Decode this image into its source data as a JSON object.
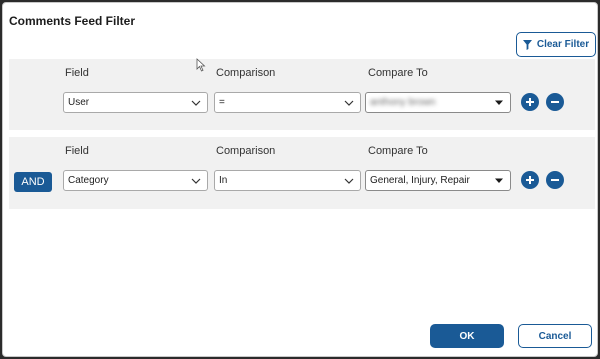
{
  "dialog": {
    "title": "Comments Feed Filter",
    "clear_filter_label": "Clear Filter"
  },
  "columns": {
    "field": "Field",
    "comparison": "Comparison",
    "compare_to": "Compare To"
  },
  "rows": [
    {
      "connector": "",
      "field": "User",
      "comparison": "=",
      "compare_to": "anthony brown",
      "compare_to_blurred": true
    },
    {
      "connector": "AND",
      "field": "Category",
      "comparison": "In",
      "compare_to": "General, Injury, Repair",
      "compare_to_blurred": false
    }
  ],
  "footer": {
    "ok_label": "OK",
    "cancel_label": "Cancel"
  },
  "colors": {
    "accent": "#1a5a96",
    "panel": "#f1f1f1"
  },
  "icons": [
    "filter-icon",
    "chevron-down-icon",
    "plus-icon",
    "minus-icon",
    "mouse-pointer-icon"
  ]
}
